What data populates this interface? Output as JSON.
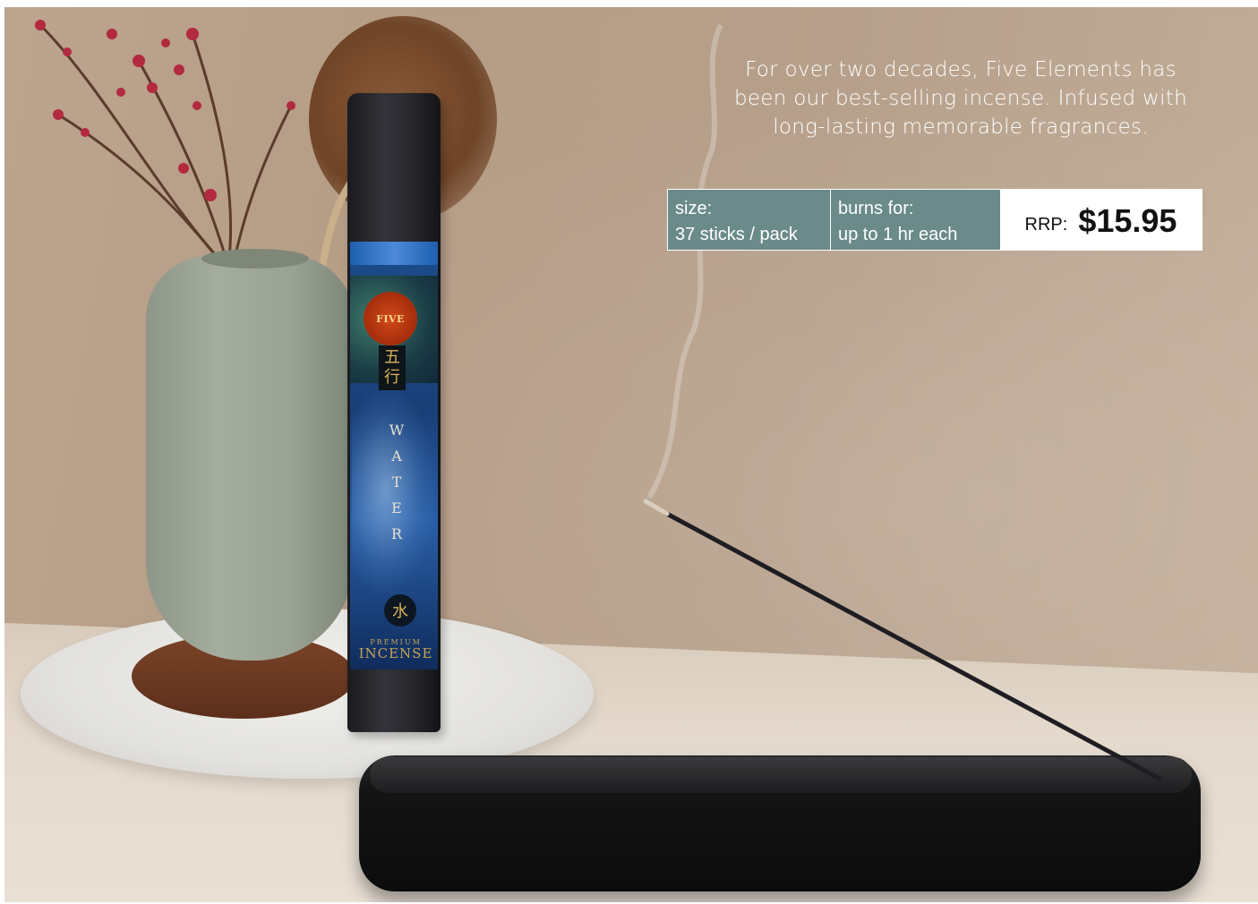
{
  "headline": {
    "line1": "For over two decades, Five Elements has",
    "line2": "been our best-selling incense. Infused with",
    "line3": "long-lasting memorable fragrances."
  },
  "specs": {
    "size_label": "size:",
    "size_value": "37 sticks / pack",
    "burn_label": "burns for:",
    "burn_value": "up to 1 hr each"
  },
  "price": {
    "label": "RRP:",
    "value": "$15.95"
  },
  "package": {
    "brand": "FIVE",
    "glyph": "五行",
    "element_word": "WATER",
    "element_glyph": "水",
    "line_small": "PREMIUM",
    "line_big": "INCENSE"
  },
  "colors": {
    "spec_panel": "#6b8a8a",
    "price_panel": "#ffffff",
    "headline_text": "#ffffff"
  }
}
